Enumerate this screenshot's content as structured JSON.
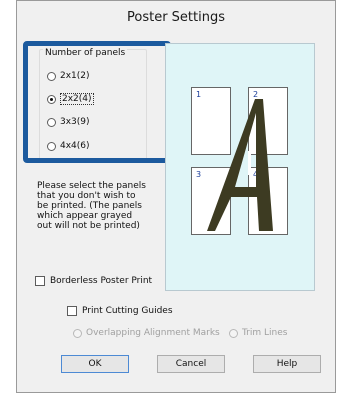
{
  "dialog": {
    "title": "Poster Settings"
  },
  "panels": {
    "group_label": "Number of panels",
    "options": [
      {
        "label": "2x1(2)",
        "mnemonic": "2",
        "selected": false
      },
      {
        "label": "2x2(4)",
        "mnemonic": "4",
        "selected": true
      },
      {
        "label": "3x3(9)",
        "mnemonic": "9",
        "selected": false
      },
      {
        "label": "4x4(6)",
        "mnemonic": "6",
        "selected": false
      }
    ]
  },
  "preview": {
    "panel_numbers": [
      "1",
      "2",
      "3",
      "4"
    ],
    "background_color": "#dff5f7",
    "letter_color": "#3d3b22"
  },
  "description": "Please select the panels that you don't wish to be printed. (The panels which appear grayed out will not be printed)",
  "options": {
    "borderless": {
      "label": "Borderless Poster Print",
      "checked": false
    },
    "cutting_guides": {
      "label": "Print Cutting Guides",
      "checked": false
    },
    "overlapping_marks": {
      "label": "Overlapping Alignment Marks",
      "enabled": false
    },
    "trim_lines": {
      "label": "Trim Lines",
      "enabled": false
    }
  },
  "buttons": {
    "ok": "OK",
    "cancel": "Cancel",
    "help": "Help"
  },
  "colors": {
    "highlight": "#1c5a9e",
    "panel_number": "#1a3d9a"
  }
}
